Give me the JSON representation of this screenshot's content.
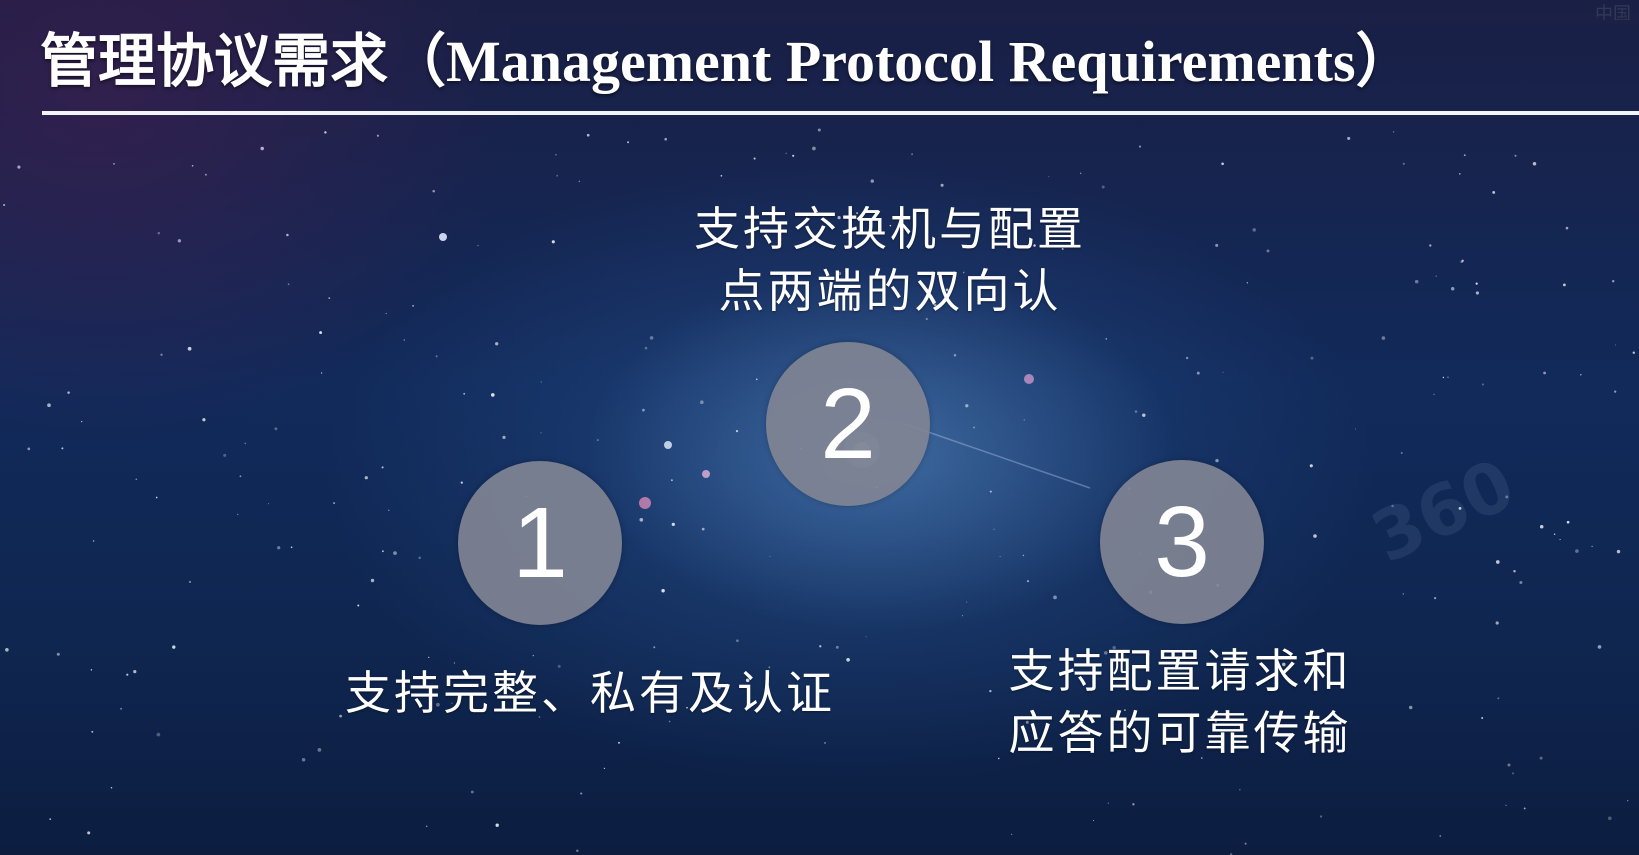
{
  "slide": {
    "title": "管理协议需求（Management Protocol Requirements）",
    "corner_logo_text": "中国"
  },
  "items": [
    {
      "number": "1",
      "caption_lines": [
        "支持完整、私有及认证"
      ]
    },
    {
      "number": "2",
      "caption_lines": [
        "支持交换机与配置",
        "点两端的双向认"
      ]
    },
    {
      "number": "3",
      "caption_lines": [
        "支持配置请求和",
        "应答的可靠传输"
      ]
    }
  ],
  "watermark_text": "360",
  "colors": {
    "background_top": "#1a1f45",
    "background_bottom": "#0c1d40",
    "circle": "#80849a",
    "text": "#ffffff"
  }
}
